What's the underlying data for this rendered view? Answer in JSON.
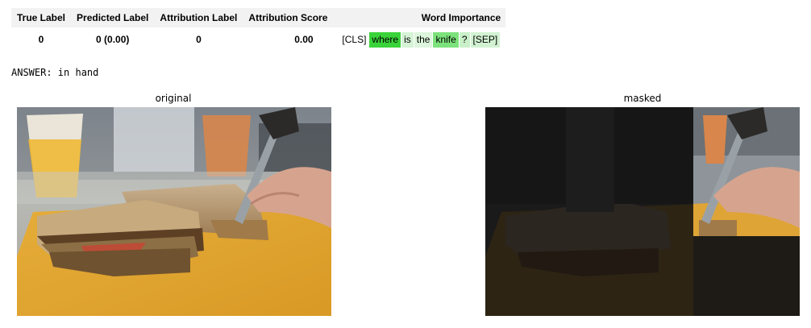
{
  "table": {
    "headers": {
      "true_label": "True Label",
      "predicted_label": "Predicted Label",
      "attribution_label": "Attribution Label",
      "attribution_score": "Attribution Score",
      "word_importance": "Word Importance"
    },
    "row": {
      "true_label": "0",
      "predicted_label": "0 (0.00)",
      "attribution_label": "0",
      "attribution_score": "0.00"
    },
    "tokens": [
      {
        "text": "[CLS]",
        "color": "#ffffff"
      },
      {
        "text": "where",
        "color": "#3ad33a"
      },
      {
        "text": "is",
        "color": "#d6f3d6"
      },
      {
        "text": "the",
        "color": "#dcf5dc"
      },
      {
        "text": "knife",
        "color": "#7ce27c"
      },
      {
        "text": "?",
        "color": "#c9f0c9"
      },
      {
        "text": "[SEP]",
        "color": "#d2f2d2"
      }
    ]
  },
  "answer": "ANSWER: in hand",
  "panels": {
    "original_title": "original",
    "masked_title": "masked"
  },
  "colors": {
    "header_bg": "#f2f2f2",
    "board": "#e3a833",
    "mask_overlay": "#111111"
  }
}
